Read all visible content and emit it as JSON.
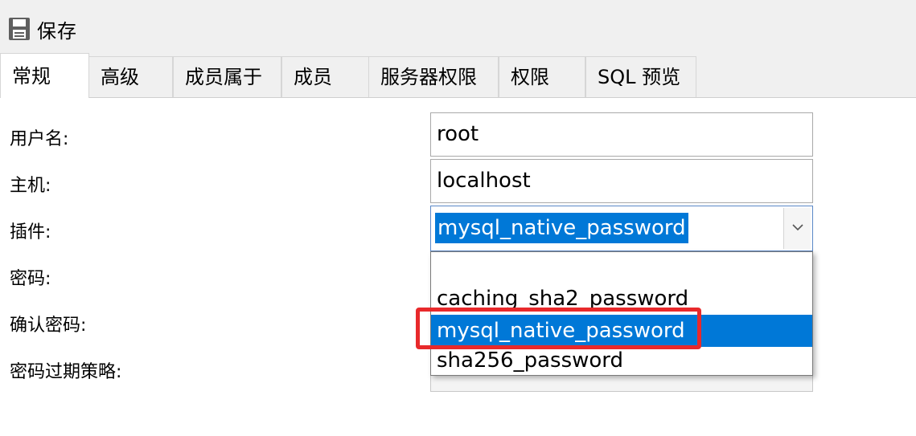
{
  "toolbar": {
    "save_label": "保存",
    "save_icon": "save-icon"
  },
  "tabs": [
    {
      "label": "常规",
      "active": true
    },
    {
      "label": "高级"
    },
    {
      "label": "成员属于"
    },
    {
      "label": "成员"
    },
    {
      "label": "服务器权限"
    },
    {
      "label": "权限"
    },
    {
      "label": "SQL 预览"
    }
  ],
  "form": {
    "username_label": "用户名:",
    "host_label": "主机:",
    "plugin_label": "插件:",
    "password_label": "密码:",
    "confirm_password_label": "确认密码:",
    "password_expire_label": "密码过期策略:",
    "username_value": "root",
    "host_value": "localhost",
    "plugin_selected": "mysql_native_password"
  },
  "plugin_options": [
    "",
    "caching_sha2_password",
    "mysql_native_password",
    "sha256_password"
  ],
  "colors": {
    "selection": "#0078d7",
    "highlight_box": "#e8292b",
    "chrome_bg": "#f0f0f0"
  }
}
